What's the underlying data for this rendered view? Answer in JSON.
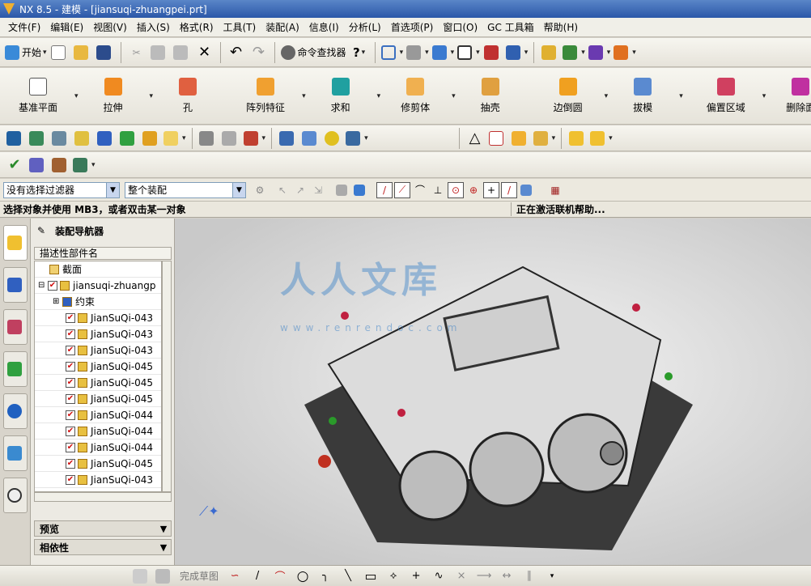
{
  "window": {
    "title": "NX 8.5 - 建模 - [jiansuqi-zhuangpei.prt]"
  },
  "menu": [
    "文件(F)",
    "编辑(E)",
    "视图(V)",
    "插入(S)",
    "格式(R)",
    "工具(T)",
    "装配(A)",
    "信息(I)",
    "分析(L)",
    "首选项(P)",
    "窗口(O)",
    "GC 工具箱",
    "帮助(H)"
  ],
  "toolbar1": {
    "start": "开始",
    "command_finder": "命令查找器"
  },
  "feature_bar": [
    "基准平面",
    "拉伸",
    "孔",
    "阵列特征",
    "求和",
    "修剪体",
    "抽壳",
    "边倒圆",
    "拔模",
    "偏置区域",
    "删除面"
  ],
  "filter": {
    "selection_filter": "没有选择过滤器",
    "scope": "整个装配"
  },
  "status": {
    "prompt": "选择对象并使用 MB3，或者双击某一对象",
    "info": "正在激活联机帮助..."
  },
  "navigator": {
    "title": "装配导航器",
    "column_header": "描述性部件名",
    "rows": [
      {
        "label": "截面",
        "checked": false
      },
      {
        "label": "jiansuqi-zhuangp",
        "checked": true
      },
      {
        "label": "约束",
        "checked": false
      },
      {
        "label": "JianSuQi-043",
        "checked": true
      },
      {
        "label": "JianSuQi-043",
        "checked": true
      },
      {
        "label": "JianSuQi-043",
        "checked": true
      },
      {
        "label": "JianSuQi-045",
        "checked": true
      },
      {
        "label": "JianSuQi-045",
        "checked": true
      },
      {
        "label": "JianSuQi-045",
        "checked": true
      },
      {
        "label": "JianSuQi-044",
        "checked": true
      },
      {
        "label": "JianSuQi-044",
        "checked": true
      },
      {
        "label": "JianSuQi-044",
        "checked": true
      },
      {
        "label": "JianSuQi-045",
        "checked": true
      },
      {
        "label": "JianSuQi-043",
        "checked": true
      }
    ],
    "preview": "预览",
    "dependency": "相依性"
  },
  "watermark": {
    "text": "人人文库",
    "url": "www.renrendoc.com"
  },
  "bottom": {
    "finish_sketch": "完成草图"
  },
  "colors": {
    "title_bar": "#2b57a8",
    "menu_bg": "#f0efe8",
    "check": "#d01010"
  }
}
